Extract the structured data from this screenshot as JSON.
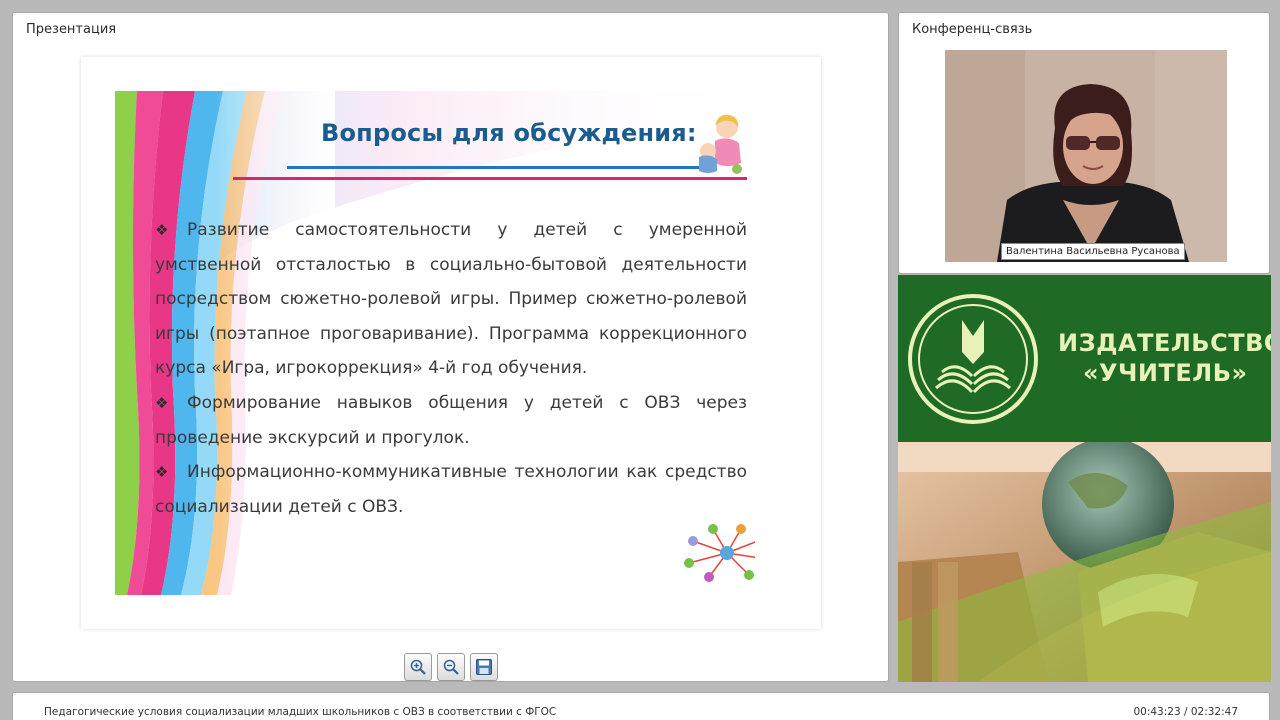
{
  "presentation": {
    "title": "Презентация",
    "slide": {
      "heading": "Вопросы для обсуждения:",
      "bullets": [
        "Развитие самостоятельности у детей с умеренной умственной отсталостью в социально-бытовой деятельности посредством сюжетно-ролевой игры. Пример сюжетно-ролевой игры (поэтапное проговаривание). Программа коррекционного курса «Игра, игрокоррекция» 4-й год обучения.",
        "Формирование навыков общения у детей с ОВЗ через проведение экскурсий и прогулок.",
        "Информационно-коммуникативные технологии как средство социализации детей с ОВЗ."
      ],
      "bullet_symbol": "❖"
    },
    "toolbar": {
      "zoom_in_icon": "zoom-in-icon",
      "zoom_out_icon": "zoom-out-icon",
      "save_icon": "save-icon"
    }
  },
  "conference": {
    "title": "Конференц-связь",
    "speaker_name": "Валентина Васильевна Русанова"
  },
  "ad": {
    "line1": "ИЗДАТЕЛЬСТВО",
    "line2": "«УЧИТЕЛЬ»",
    "colors": {
      "banner": "#1f6b26",
      "text": "#e8f1b8"
    }
  },
  "footer": {
    "title": "Педагогические условия социализации младших школьников с ОВЗ в соответствии с ФГОС",
    "time": "00:43:23 / 02:32:47"
  }
}
